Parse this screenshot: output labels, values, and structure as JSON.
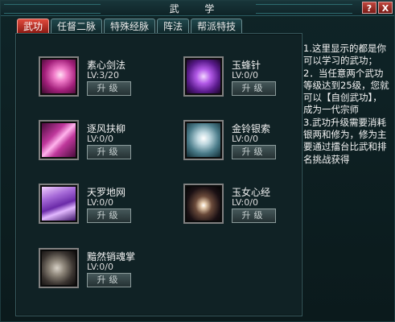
{
  "window": {
    "title": "武 学",
    "help_label": "?",
    "close_label": "X"
  },
  "tabs": [
    {
      "label": "武功",
      "active": true
    },
    {
      "label": "任督二脉",
      "active": false
    },
    {
      "label": "特殊经脉",
      "active": false
    },
    {
      "label": "阵法",
      "active": false
    },
    {
      "label": "帮派特技",
      "active": false
    }
  ],
  "skills": [
    {
      "name": "素心剑法",
      "level": "LV:3/20",
      "button": "升级",
      "icon": "plum-sword-icon"
    },
    {
      "name": "玉蜂针",
      "level": "LV:0/0",
      "button": "升级",
      "icon": "violet-swirl-icon"
    },
    {
      "name": "逐风扶柳",
      "level": "LV:0/0",
      "button": "升级",
      "icon": "magenta-streak-icon"
    },
    {
      "name": "金铃银索",
      "level": "LV:0/0",
      "button": "升级",
      "icon": "silver-tornado-icon"
    },
    {
      "name": "天罗地网",
      "level": "LV:0/0",
      "button": "升级",
      "icon": "lightning-net-icon"
    },
    {
      "name": "玉女心经",
      "level": "LV:0/0",
      "button": "升级",
      "icon": "galaxy-icon"
    },
    {
      "name": "黯然销魂掌",
      "level": "LV:0/0",
      "button": "升级",
      "icon": "shadow-face-icon"
    }
  ],
  "info_text": "1.这里显示的都是你可以学习的武功；\n2．当任意两个武功等级达到25级，您就可以【自创武功】，成为一代宗师\n3.武功升级需要消耗银两和修为，修为主要通过擂台比武和排名挑战获得",
  "colors": {
    "accent_red": "#c0342a",
    "panel": "#102225",
    "text": "#f2f2f2"
  }
}
